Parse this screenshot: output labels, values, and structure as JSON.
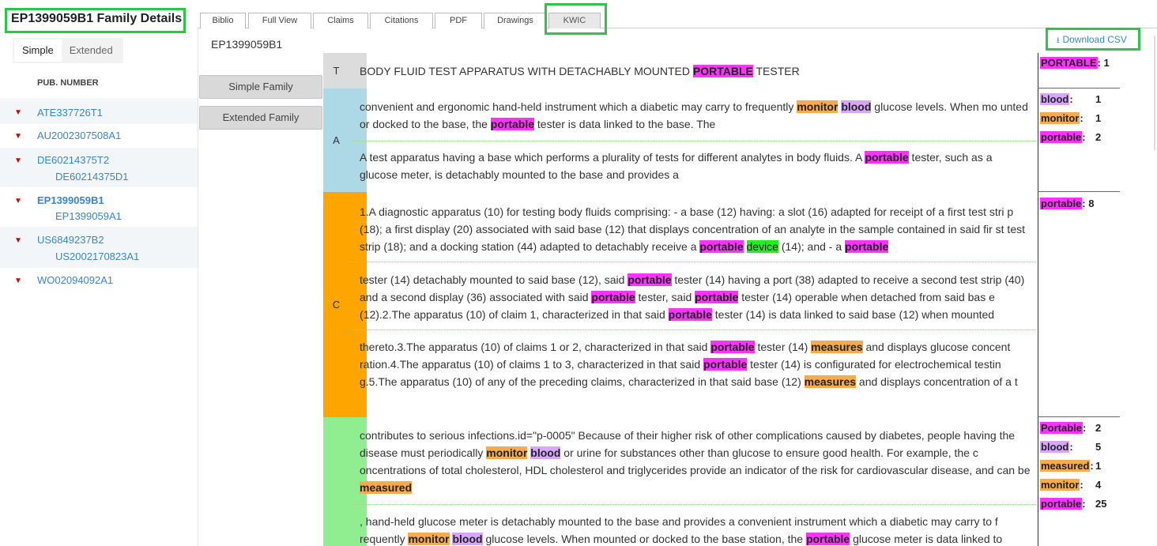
{
  "left": {
    "title": "EP1399059B1 Family Details",
    "toggle": {
      "simple": "Simple",
      "extended": "Extended"
    },
    "column_header": "PUB. NUMBER",
    "rows": [
      {
        "pub": "ATE337726T1",
        "sub": ""
      },
      {
        "pub": "AU2002307508A1",
        "sub": ""
      },
      {
        "pub": "DE60214375T2",
        "sub": "DE60214375D1"
      },
      {
        "pub": "EP1399059B1",
        "sub": "EP1399059A1"
      },
      {
        "pub": "US6849237B2",
        "sub": "US2002170823A1"
      },
      {
        "pub": "WO02094092A1",
        "sub": ""
      }
    ]
  },
  "tabs": [
    "Biblio",
    "Full View",
    "Claims",
    "Citations",
    "PDF",
    "Drawings",
    "KWIC"
  ],
  "main": {
    "pub_id": "EP1399059B1",
    "simple_family": "Simple Family",
    "extended_family": "Extended Family",
    "download_csv": "Download CSV"
  },
  "sections": {
    "T": {
      "label": "T",
      "text": "BODY FLUID TEST APPARATUS WITH DETACHABLY MOUNTED [[PORTABLE|m]] TESTER",
      "counts": [
        {
          "kw": "PORTABLE",
          "n": "1",
          "c": "m"
        }
      ]
    },
    "A": {
      "label": "A",
      "paragraphs": [
        "convenient and ergonomic hand-held instrument which a diabetic may carry to frequently [[monitor|o]] [[blood|p]] glucose levels. When mo unted or docked to the base, the [[portable|m]] tester is data linked to the base. The",
        "A test apparatus having a base which performs a plurality of tests for different analytes in body fluids. A [[portable|m]] tester, such as a glucose meter, is detachably mounted to the base and provides a"
      ],
      "counts": [
        {
          "kw": "blood",
          "n": "1",
          "c": "p"
        },
        {
          "kw": "monitor",
          "n": "1",
          "c": "o"
        },
        {
          "kw": "portable",
          "n": "2",
          "c": "m"
        }
      ]
    },
    "C": {
      "label": "C",
      "paragraphs": [
        "1.A diagnostic apparatus (10) for testing body fluids comprising: - a base (12) having: a slot (16) adapted for receipt of a first test stri p (18); a first display (20) associated with said base (12) that displays concentration of an analyte in the sample contained in said fir st test strip (18); and a docking station (44) adapted to detachably receive a [[portable|m]] [[device|g]] (14); and - a [[portable|m]]",
        "tester (14) detachably mounted to said base (12), said [[portable|m]] tester (14) having a port (38) adapted to receive a second test strip (40) and a second display (36) associated with said [[portable|m]] tester, said [[portable|m]] tester (14) operable when detached from said bas e (12).2.The apparatus (10) of claim 1, characterized in that said [[portable|m]] tester (14) is data linked to said base (12) when mounted",
        "thereto.3.The apparatus (10) of claims 1 or 2, characterized in that said [[portable|m]] tester (14) [[measures|o]] and displays glucose concent ration.4.The apparatus (10) of claims 1 to 3, characterized in that said [[portable|m]] tester (14) is configurated for electrochemical testin g.5.The apparatus (10) of any of the preceding claims, characterized in that said base (12) [[measures|o]] and displays concentration of a t"
      ],
      "counts": [
        {
          "kw": "portable",
          "n": "8",
          "c": "m"
        }
      ]
    },
    "D": {
      "label": "",
      "paragraphs": [
        "contributes to serious infections.id=\"p-0005\" Because of their higher risk of other complications caused by diabetes, people having the disease must periodically [[monitor|o]] [[blood|p]] or urine for substances other than glucose to ensure good health. For example, the c oncentrations of total cholesterol, HDL cholesterol and triglycerides provide an indicator of the risk for cardiovascular disease, and can be [[measured|o]]",
        ", hand-held glucose meter is detachably mounted to the base and provides a convenient instrument which a diabetic may carry to f requently [[monitor|o]] [[blood|p]] glucose levels. When mounted or docked to the base station, the [[portable|m]] glucose meter is data linked to"
      ],
      "counts": [
        {
          "kw": "Portable",
          "n": "2",
          "c": "m"
        },
        {
          "kw": "blood",
          "n": "5",
          "c": "p"
        },
        {
          "kw": "measured",
          "n": "1",
          "c": "o"
        },
        {
          "kw": "monitor",
          "n": "4",
          "c": "o"
        },
        {
          "kw": "portable",
          "n": "25",
          "c": "m"
        }
      ]
    }
  },
  "colors": {
    "section_T": "#dcdcdc",
    "section_A": "#add8e6",
    "section_C": "#ffa500",
    "section_D": "#90ee90",
    "hl_magenta": "#ff33ff",
    "hl_orange": "#f6ab4c",
    "hl_purple": "#d9a6ff",
    "hl_green": "#22ee22",
    "link": "#3a86c8",
    "highlight_box": "#2ec44b"
  },
  "icons": {
    "expand": "triangle-down-icon",
    "download": "download-icon"
  }
}
